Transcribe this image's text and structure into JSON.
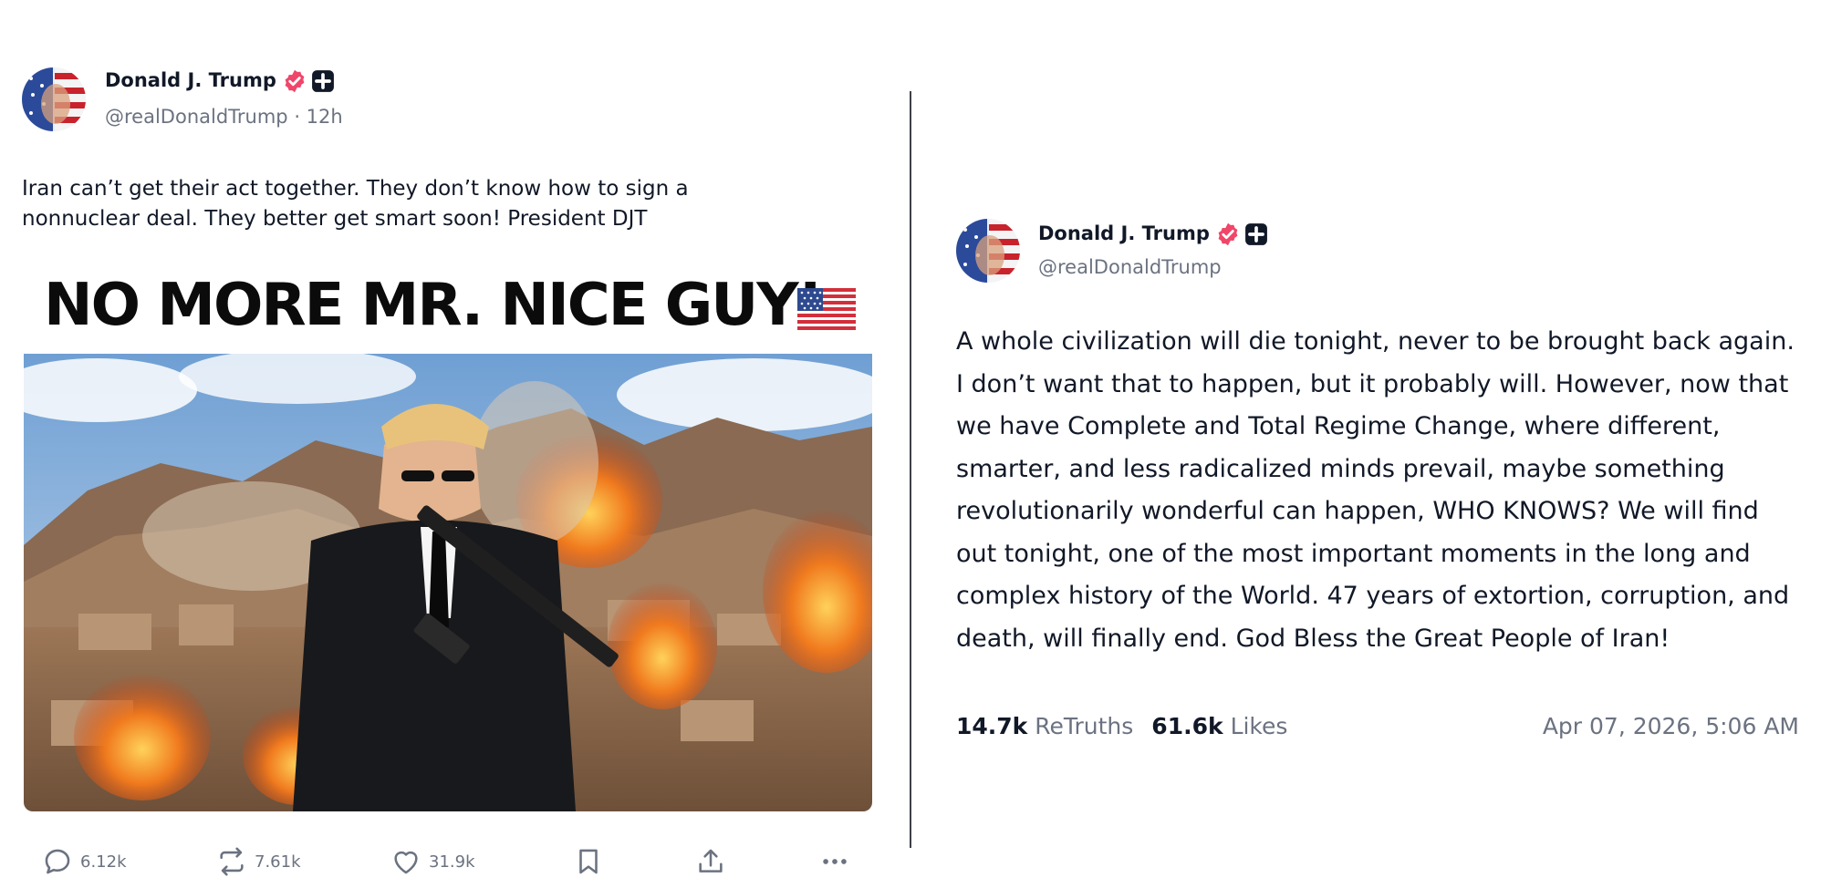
{
  "left_post": {
    "author": {
      "name": "Donald J. Trump",
      "handle": "@realDonaldTrump",
      "time_sep": " · ",
      "time": "12h"
    },
    "text": "Iran can’t get their act together. They don’t know how to sign a nonnuclear deal. They better get smart soon! President DJT",
    "image": {
      "headline": "NO MORE MR. NICE GUY!",
      "flag_icon": "us-flag-emoji",
      "photo": "man in black suit and sunglasses holding a rifle walking in front of desert mountains with explosions"
    },
    "actions": {
      "reply_count": "6.12k",
      "retruth_count": "7.61k",
      "like_count": "31.9k"
    }
  },
  "right_post": {
    "author": {
      "name": "Donald J. Trump",
      "handle": "@realDonaldTrump"
    },
    "text": "A whole civilization will die tonight, never to be brought back again. I don’t want that to happen, but it probably will. However, now that we have Complete and Total Regime Change, where different, smarter, and less radicalized minds prevail, maybe something revolutionarily wonderful can happen, WHO KNOWS? We will find out tonight, one of the most important moments in the long and complex history of the World. 47 years of extortion, corruption, and death, will finally end. God Bless the Great People of Iran!",
    "stats": {
      "retruths_value": "14.7k",
      "retruths_label": "ReTruths",
      "likes_value": "61.6k",
      "likes_label": "Likes"
    },
    "timestamp": "Apr 07, 2026, 5:06 AM"
  },
  "colors": {
    "verified_badge": "#f0466a",
    "plus_badge": "#111827",
    "muted_text": "#6b7280",
    "divider": "#3f3f46"
  }
}
